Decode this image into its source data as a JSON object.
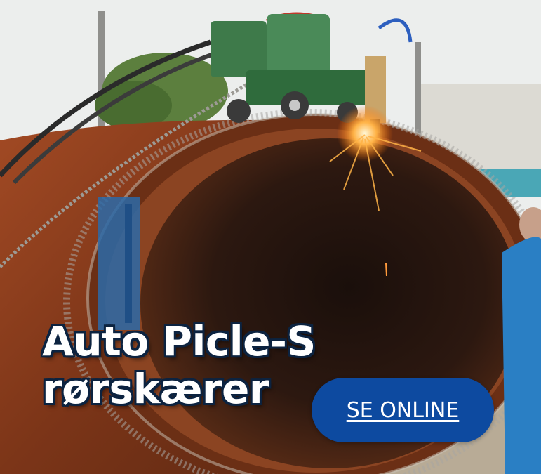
{
  "banner": {
    "headline_line1": "Auto Picle-S",
    "headline_line2": "rørskærer",
    "cta_label": "SE ONLINE"
  },
  "colors": {
    "cta_background": "#0d4aa0",
    "headline_outline": "#0c2340",
    "pipe_rust": "#8a3d1e"
  }
}
